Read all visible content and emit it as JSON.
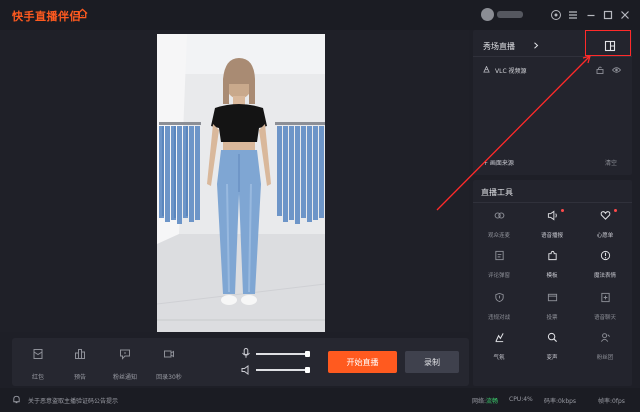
{
  "titlebar": {
    "app_title": "快手直播伴侣",
    "icons": [
      "home-icon",
      "settings-icon",
      "menu-icon",
      "minimize-icon",
      "maximize-icon",
      "close-icon"
    ]
  },
  "scene_panel": {
    "title": "秀场直播",
    "sources": [
      {
        "label": "VLC 视频源",
        "icon": "vlc-cone-icon"
      }
    ],
    "add_source_label": "+ 画面来源",
    "clear_label": "清空"
  },
  "tools_panel": {
    "title": "直播工具",
    "tools": [
      {
        "label": "观众连麦",
        "icon": "link-mic-icon",
        "enabled": false,
        "badge": false
      },
      {
        "label": "语音播报",
        "icon": "speaker-broadcast-icon",
        "enabled": true,
        "badge": true
      },
      {
        "label": "心愿单",
        "icon": "heart-icon",
        "enabled": true,
        "badge": true
      },
      {
        "label": "评论弹窗",
        "icon": "comment-popup-icon",
        "enabled": false,
        "badge": false
      },
      {
        "label": "模板",
        "icon": "puzzle-icon",
        "enabled": true,
        "badge": false
      },
      {
        "label": "魔法表情",
        "icon": "magic-face-icon",
        "enabled": true,
        "badge": false
      },
      {
        "label": "违规对战",
        "icon": "shield-battle-icon",
        "enabled": false,
        "badge": false
      },
      {
        "label": "投票",
        "icon": "vote-icon",
        "enabled": false,
        "badge": false
      },
      {
        "label": "语音聊天",
        "icon": "voice-chat-icon",
        "enabled": false,
        "badge": false
      },
      {
        "label": "气氛",
        "icon": "atmosphere-icon",
        "enabled": true,
        "badge": false
      },
      {
        "label": "变声",
        "icon": "voice-change-icon",
        "enabled": true,
        "badge": false
      },
      {
        "label": "粉丝团",
        "icon": "fan-club-icon",
        "enabled": false,
        "badge": false
      }
    ]
  },
  "controls": {
    "items": [
      {
        "label": "红包",
        "icon": "red-packet-icon"
      },
      {
        "label": "预告",
        "icon": "preview-icon"
      },
      {
        "label": "粉丝通知",
        "icon": "fan-notice-icon"
      },
      {
        "label": "回录30秒",
        "icon": "replay-record-icon"
      }
    ],
    "mic_volume": 1.0,
    "speaker_volume": 1.0,
    "start_live_label": "开始直播",
    "record_label": "录制"
  },
  "statusbar": {
    "notice": "关于恶意盗取主播验证码公告提示",
    "network_label": "网络:",
    "network_value": "流畅",
    "cpu": "CPU:4%",
    "bitrate": "码率:0kbps",
    "framerate": "帧率:0fps"
  },
  "colors": {
    "accent": "#ff5a1f",
    "background": "#1e1f27",
    "panel": "#23242d",
    "highlight_box": "#ff2a2a",
    "network_ok": "#3ccf6e"
  }
}
